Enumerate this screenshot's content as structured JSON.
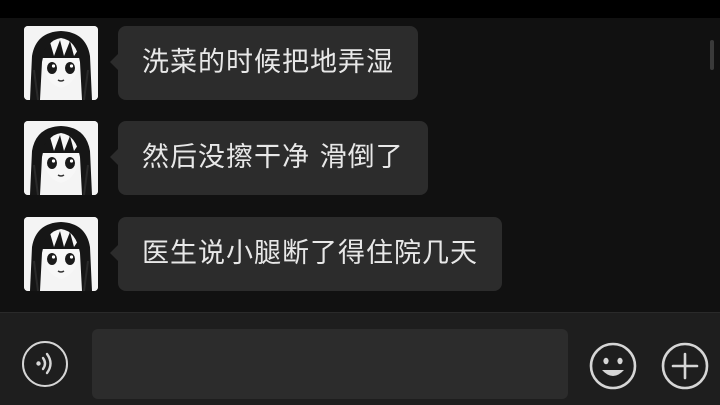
{
  "chat": {
    "messages": [
      {
        "sender": "other",
        "avatar_icon": "anime-girl-avatar-icon",
        "text": "洗菜的时候把地弄湿"
      },
      {
        "sender": "other",
        "avatar_icon": "anime-girl-avatar-icon",
        "text": "然后没擦干净 滑倒了"
      },
      {
        "sender": "other",
        "avatar_icon": "anime-girl-avatar-icon",
        "text": "医生说小腿断了得住院几天"
      }
    ]
  },
  "input_bar": {
    "voice_icon": "voice-input-icon",
    "message_value": "",
    "emoji_icon": "emoji-smiley-icon",
    "plus_icon": "plus-icon"
  },
  "colors": {
    "background": "#111111",
    "bubble": "#2c2c2c",
    "bubble_text": "#e8e8e8",
    "input_bar": "#1e1e1e",
    "icon": "#d6d6d6"
  }
}
